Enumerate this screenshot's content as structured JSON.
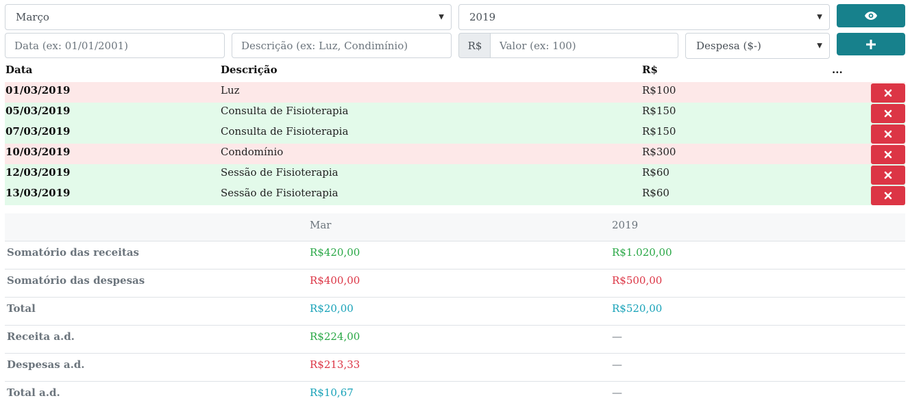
{
  "filters": {
    "month": "Março",
    "year": "2019"
  },
  "form": {
    "date_placeholder": "Data (ex: 01/01/2001)",
    "description_placeholder": "Descrição (ex: Luz, Condimínio)",
    "currency_prefix": "R$",
    "value_placeholder": "Valor (ex: 100)",
    "type_selected": "Despesa ($-)"
  },
  "table": {
    "headers": [
      "Data",
      "Descrição",
      "R$",
      "..."
    ],
    "rows": [
      {
        "date": "01/03/2019",
        "description": "Luz",
        "value": "R$100",
        "type": "expense"
      },
      {
        "date": "05/03/2019",
        "description": "Consulta de Fisioterapia",
        "value": "R$150",
        "type": "income"
      },
      {
        "date": "07/03/2019",
        "description": "Consulta de Fisioterapia",
        "value": "R$150",
        "type": "income"
      },
      {
        "date": "10/03/2019",
        "description": "Condomínio",
        "value": "R$300",
        "type": "expense"
      },
      {
        "date": "12/03/2019",
        "description": "Sessão de Fisioterapia",
        "value": "R$60",
        "type": "income"
      },
      {
        "date": "13/03/2019",
        "description": "Sessão de Fisioterapia",
        "value": "R$60",
        "type": "income"
      }
    ]
  },
  "summary": {
    "headers": [
      "",
      "Mar",
      "2019"
    ],
    "rows": [
      {
        "label": "Somatório das receitas",
        "month": "R$420,00",
        "year": "R$1.020,00",
        "tone": "green"
      },
      {
        "label": "Somatório das despesas",
        "month": "R$400,00",
        "year": "R$500,00",
        "tone": "red"
      },
      {
        "label": "Total",
        "month": "R$20,00",
        "year": "R$520,00",
        "tone": "teal"
      },
      {
        "label": "Receita a.d.",
        "month": "R$224,00",
        "year": "—",
        "tone": "green"
      },
      {
        "label": "Despesas a.d.",
        "month": "R$213,33",
        "year": "—",
        "tone": "red"
      },
      {
        "label": "Total a.d.",
        "month": "R$10,67",
        "year": "—",
        "tone": "teal"
      }
    ]
  },
  "icons": {
    "view": "eye-icon",
    "add": "plus-icon",
    "delete": "close-icon"
  },
  "colors": {
    "accent": "#17818c",
    "danger": "#dc3545",
    "income_row": "#e3faea",
    "expense_row": "#fde8e8"
  }
}
